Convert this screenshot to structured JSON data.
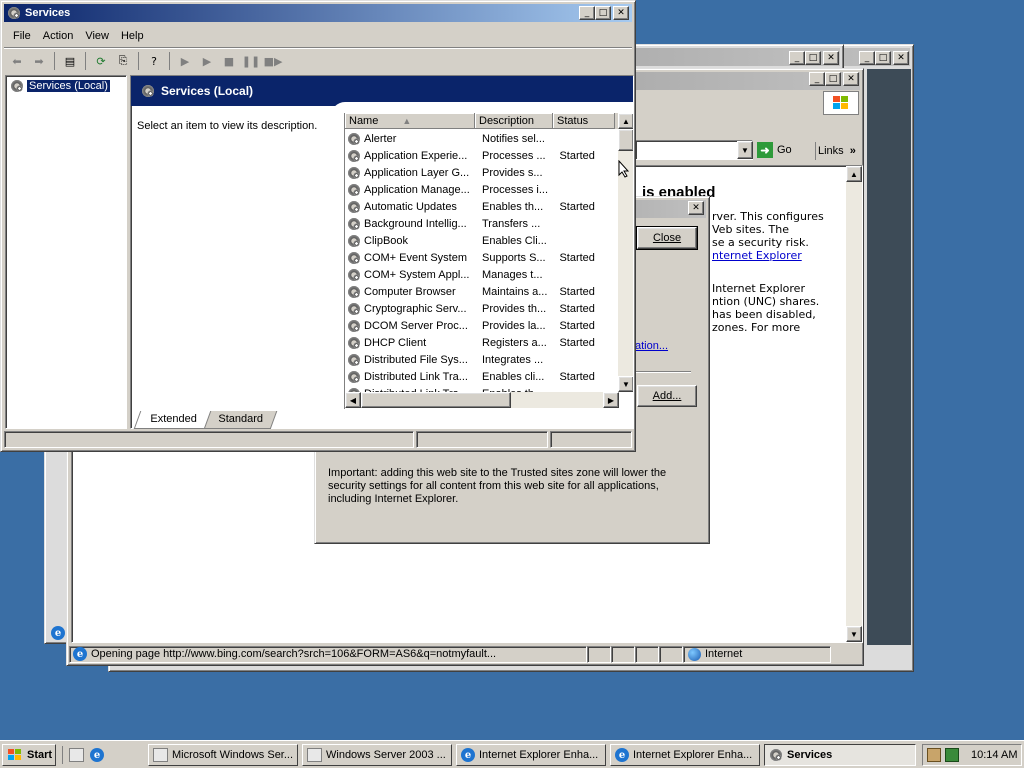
{
  "services_window": {
    "title": "Services",
    "menu": [
      "File",
      "Action",
      "View",
      "Help"
    ],
    "tree_item": "Services (Local)",
    "header_title": "Services (Local)",
    "description_prompt": "Select an item to view its description.",
    "columns": [
      "Name",
      "Description",
      "Status"
    ],
    "rows": [
      {
        "name": "Alerter",
        "desc": "Notifies sel...",
        "status": ""
      },
      {
        "name": "Application Experie...",
        "desc": "Processes ...",
        "status": "Started"
      },
      {
        "name": "Application Layer G...",
        "desc": "Provides s...",
        "status": ""
      },
      {
        "name": "Application Manage...",
        "desc": "Processes i...",
        "status": ""
      },
      {
        "name": "Automatic Updates",
        "desc": "Enables th...",
        "status": "Started"
      },
      {
        "name": "Background Intellig...",
        "desc": "Transfers ...",
        "status": ""
      },
      {
        "name": "ClipBook",
        "desc": "Enables Cli...",
        "status": ""
      },
      {
        "name": "COM+ Event System",
        "desc": "Supports S...",
        "status": "Started"
      },
      {
        "name": "COM+ System Appl...",
        "desc": "Manages t...",
        "status": ""
      },
      {
        "name": "Computer Browser",
        "desc": "Maintains a...",
        "status": "Started"
      },
      {
        "name": "Cryptographic Serv...",
        "desc": "Provides th...",
        "status": "Started"
      },
      {
        "name": "DCOM Server Proc...",
        "desc": "Provides la...",
        "status": "Started"
      },
      {
        "name": "DHCP Client",
        "desc": "Registers a...",
        "status": "Started"
      },
      {
        "name": "Distributed File Sys...",
        "desc": "Integrates ...",
        "status": ""
      },
      {
        "name": "Distributed Link Tra...",
        "desc": "Enables cli...",
        "status": "Started"
      },
      {
        "name": "Distributed Link Tra...",
        "desc": "Enables th...",
        "status": ""
      }
    ],
    "tabs": [
      "Extended",
      "Standard"
    ]
  },
  "ie_window": {
    "go_label": "Go",
    "links_label": "Links",
    "heading": "is enabled",
    "para1": [
      "rver. This configures",
      "Veb sites. The",
      "se a security risk."
    ],
    "link1": "nternet Explorer",
    "para2": [
      "Internet Explorer",
      "ntion (UNC) shares.",
      "has been disabled,",
      "zones. For more"
    ],
    "link2": "ation...",
    "status_text": "Opening page http://www.bing.com/search?srch=106&FORM=AS6&q=notmyfault...",
    "zone": "Internet"
  },
  "dialog": {
    "close_label": "Close",
    "add_label": "Add...",
    "important_text": "Important: adding this web site to the Trusted sites zone will lower the security settings for all content from this web site for all applications, including Internet Explorer."
  },
  "taskbar": {
    "start_label": "Start",
    "items": [
      "Microsoft Windows Ser...",
      "Windows Server 2003 ...",
      "Internet Explorer Enha...",
      "Internet Explorer Enha...",
      "Services"
    ],
    "clock": "10:14 AM"
  }
}
